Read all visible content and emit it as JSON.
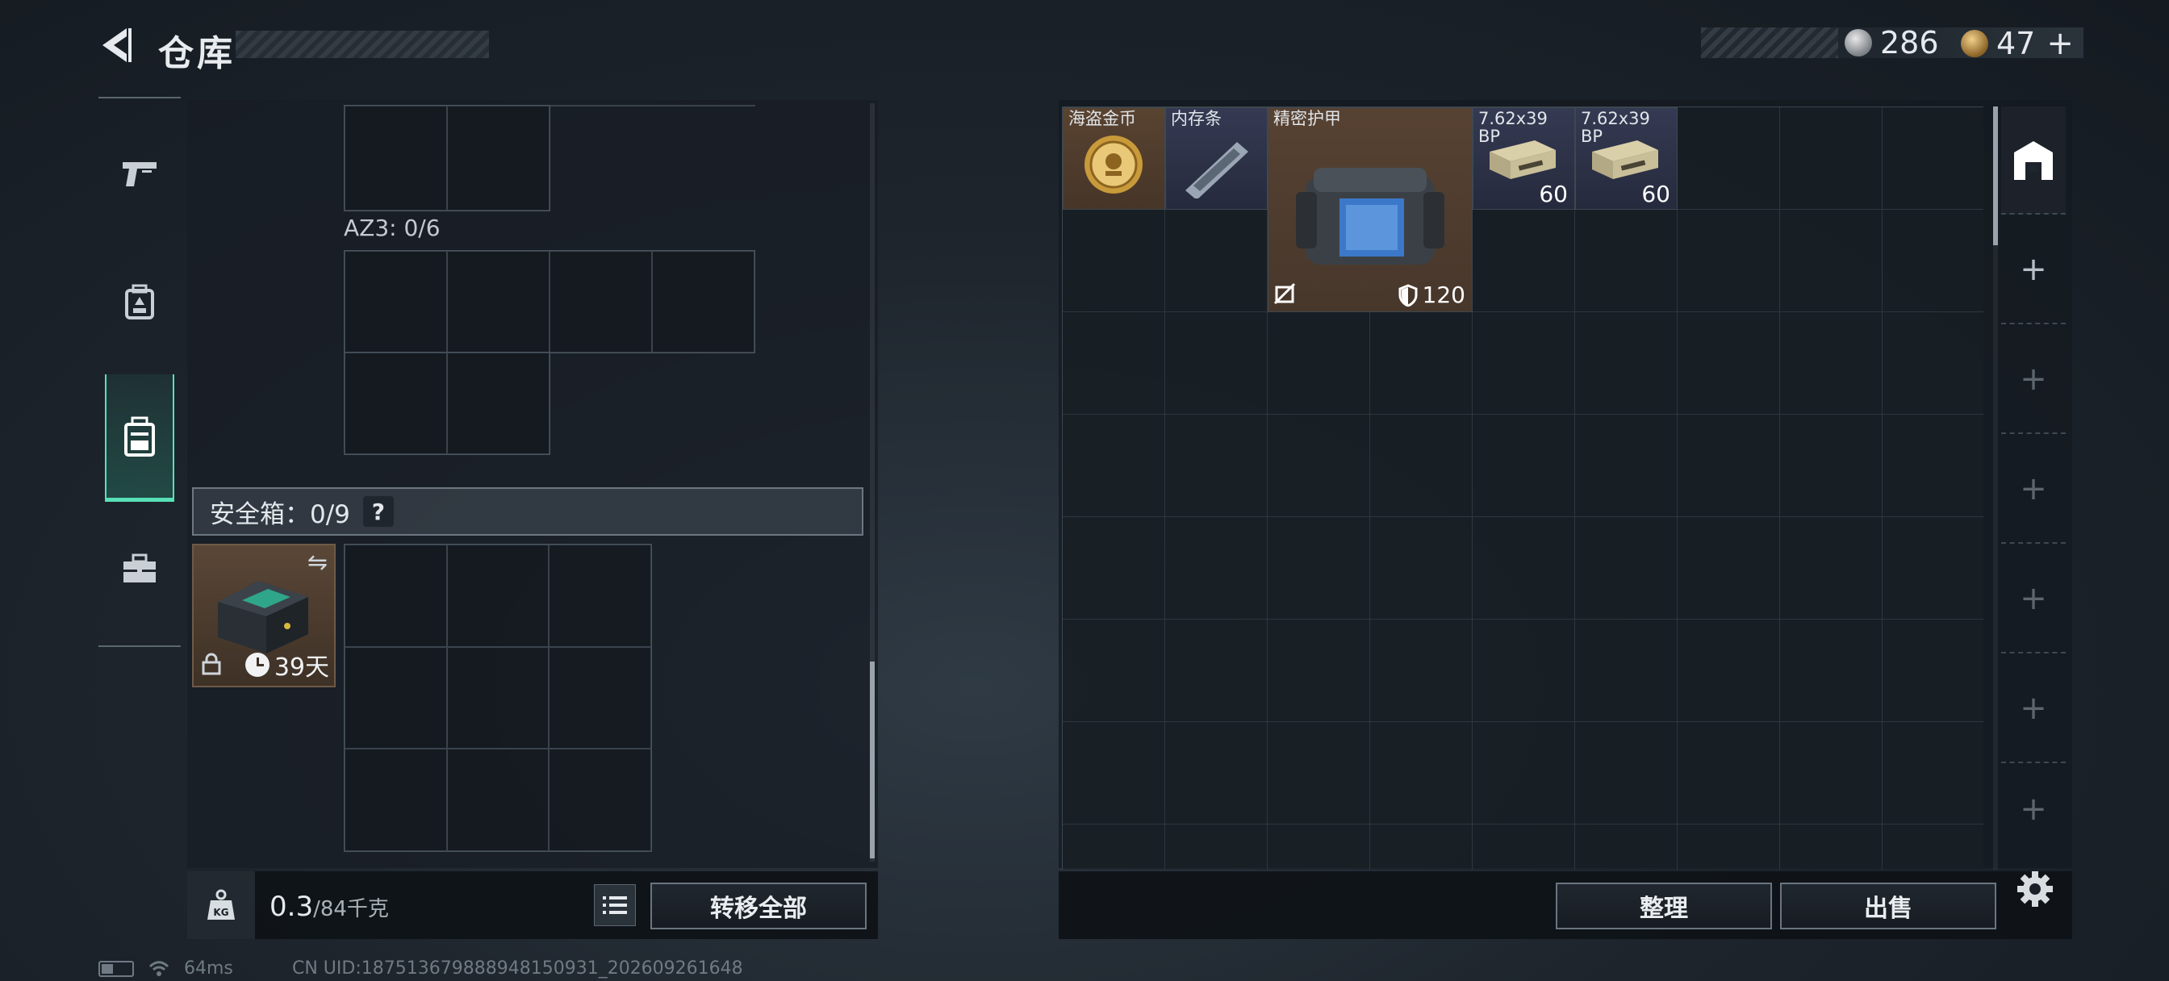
{
  "header": {
    "title": "仓库"
  },
  "currency": [
    {
      "icon": "silver-coin-icon",
      "value": "286"
    },
    {
      "icon": "gold-coin-icon",
      "value": "47"
    }
  ],
  "left": {
    "rail": [
      "pistol-icon",
      "backpack-icon",
      "chest-rig-icon",
      "toolbox-icon"
    ],
    "az3_label": "AZ3: 0/6",
    "safe_label": "安全箱：0/9",
    "safe_help": "?",
    "safe_time": "39天",
    "weight_value": "0.3",
    "weight_max": "/84千克",
    "transfer_all": "转移全部"
  },
  "stash": {
    "items": [
      {
        "name": "海盗金币",
        "qty": ""
      },
      {
        "name": "内存条",
        "qty": ""
      },
      {
        "name": "精密护甲",
        "durability": "120"
      },
      {
        "name": "7.62x39 BP",
        "qty": "60"
      },
      {
        "name": "7.62x39 BP",
        "qty": "60"
      }
    ]
  },
  "right": {
    "sort": "整理",
    "sell": "出售"
  },
  "status": {
    "ping": "64ms",
    "uid": "CN UID:187513679888948150931_202609261648"
  },
  "colors": {
    "accent": "#58e0b8",
    "item_orange_bg": "#594331",
    "item_blue_bg": "#343a52"
  }
}
